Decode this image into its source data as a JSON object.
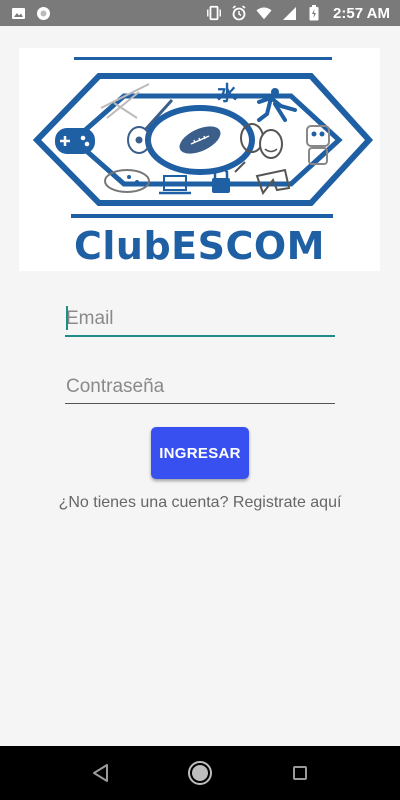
{
  "status_bar": {
    "time": "2:57 AM",
    "left_icons": [
      "image-icon",
      "circle-icon"
    ],
    "right_icons": [
      "vibrate-icon",
      "alarm-icon",
      "wifi-icon",
      "signal-icon",
      "battery-icon"
    ]
  },
  "logo": {
    "text": "ClubESCOM",
    "brand_color": "#1f5fa3",
    "kanji": "水"
  },
  "form": {
    "email_placeholder": "Email",
    "email_value": "",
    "password_placeholder": "Contraseña",
    "password_value": "",
    "accent_color": "#1f8d86"
  },
  "login_button": {
    "label": "INGRESAR",
    "color": "#3850f0"
  },
  "register_link": {
    "text": "¿No tienes una cuenta? Registrate aquí"
  },
  "nav_bar": {
    "icons": [
      "back-icon",
      "home-icon",
      "recents-icon"
    ]
  }
}
